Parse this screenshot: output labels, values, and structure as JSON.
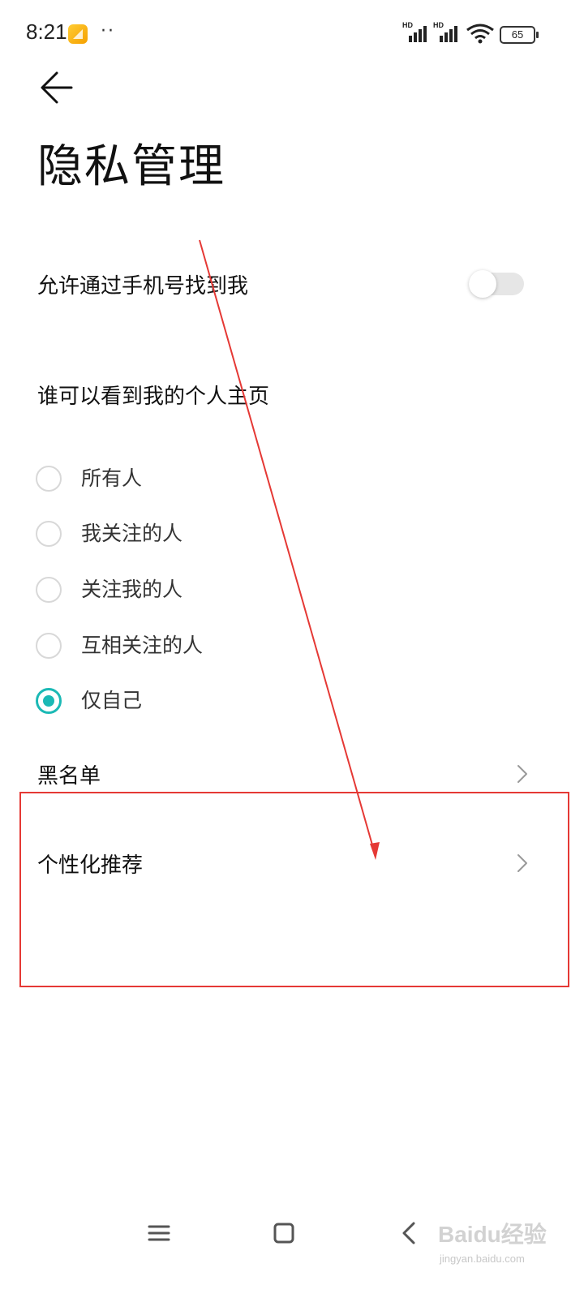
{
  "status_bar": {
    "time": "8:21",
    "dots": "··",
    "signal_1_label": "HD",
    "signal_2_label": "HD",
    "battery_level": "65",
    "icons": [
      "notification-gallery-icon",
      "signal-icon",
      "signal-icon",
      "wifi-icon",
      "battery-icon"
    ]
  },
  "header": {
    "back_icon": "arrow-left-icon",
    "title": "隐私管理"
  },
  "settings": {
    "find_by_phone": {
      "label": "允许通过手机号找到我",
      "enabled": false
    },
    "profile_visibility": {
      "title": "谁可以看到我的个人主页",
      "options": [
        {
          "label": "所有人",
          "selected": false
        },
        {
          "label": "我关注的人",
          "selected": false
        },
        {
          "label": "关注我的人",
          "selected": false
        },
        {
          "label": "互相关注的人",
          "selected": false
        },
        {
          "label": "仅自己",
          "selected": true
        }
      ]
    },
    "blacklist": {
      "label": "黑名单"
    },
    "personalized": {
      "label": "个性化推荐"
    }
  },
  "nav_bar": {
    "icons": [
      "menu-icon",
      "home-square-icon",
      "back-chevron-icon"
    ]
  },
  "watermark": {
    "brand": "Baidu经验",
    "sub": "jingyan.baidu.com"
  },
  "colors": {
    "accent": "#1bb9b5",
    "annotation": "#e53935",
    "text": "#111111"
  }
}
